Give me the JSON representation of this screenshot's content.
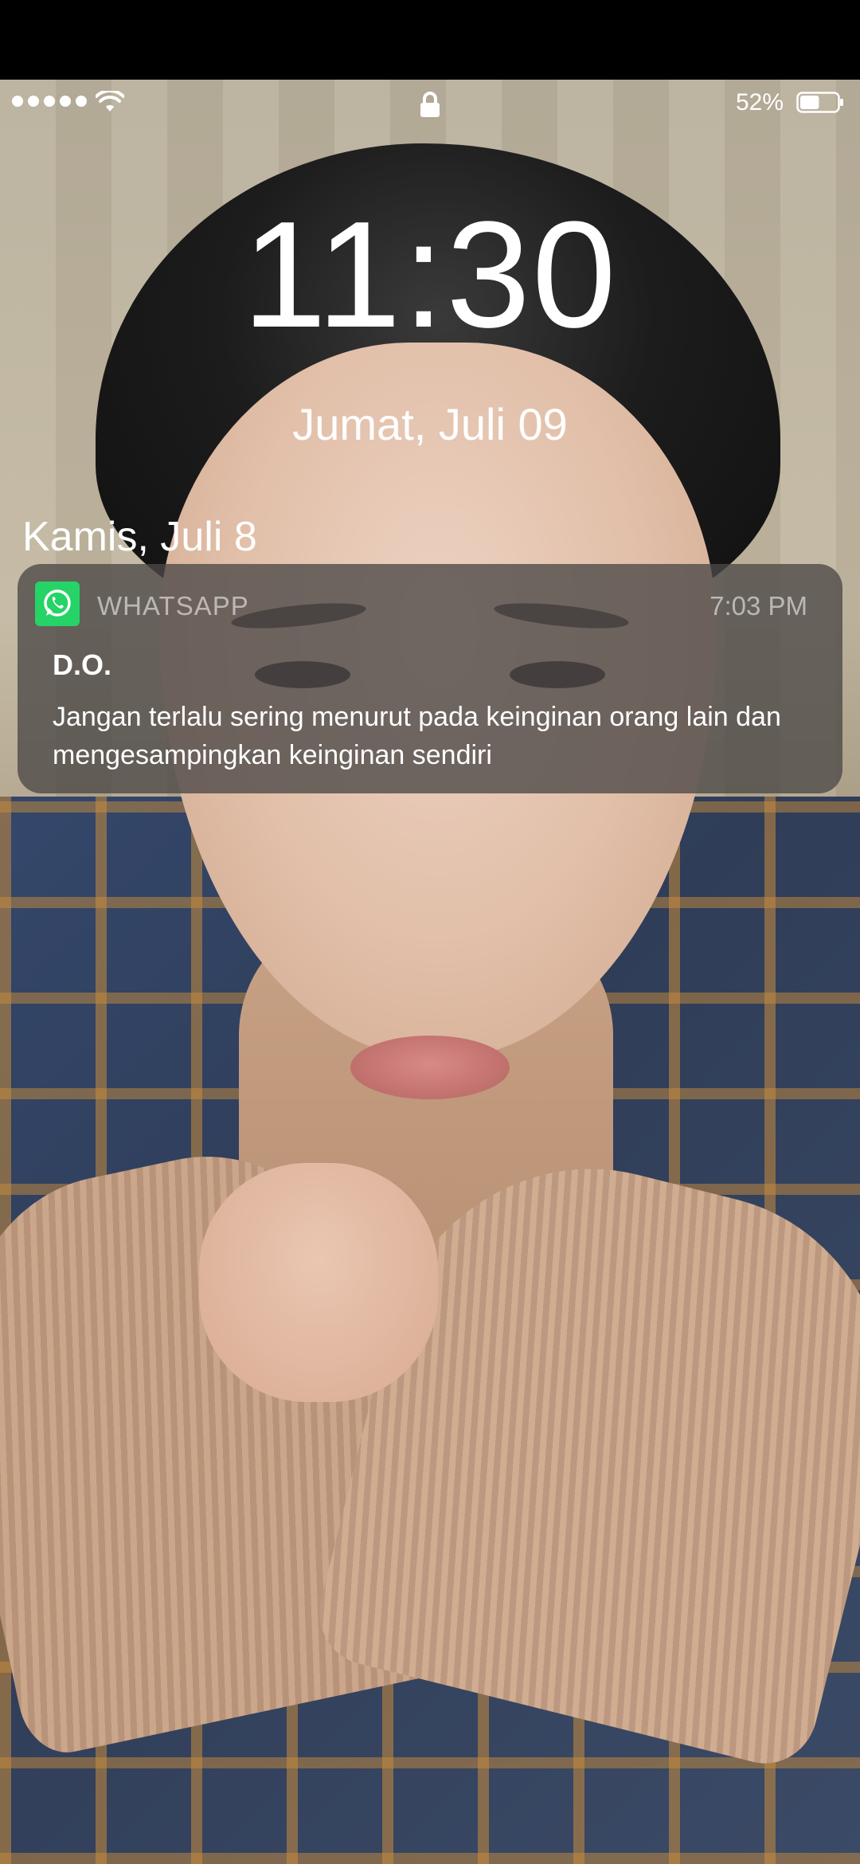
{
  "status_bar": {
    "signal_bars": 5,
    "battery_percent": "52%",
    "battery_level": 0.52,
    "icons": [
      "signal-icon",
      "wifi-icon",
      "lock-icon",
      "battery-icon"
    ]
  },
  "lock_screen": {
    "time": "11:30",
    "date": "Jumat, Juli 09",
    "section_date": "Kamis, Juli 8"
  },
  "notification": {
    "app_icon": "whatsapp-icon",
    "app_name": "WHATSAPP",
    "time": "7:03 PM",
    "sender": "D.O.",
    "message": "Jangan terlalu sering menurut pada keinginan orang lain dan mengesampingkan keinginan sendiri",
    "accent_color": "#25D366"
  }
}
